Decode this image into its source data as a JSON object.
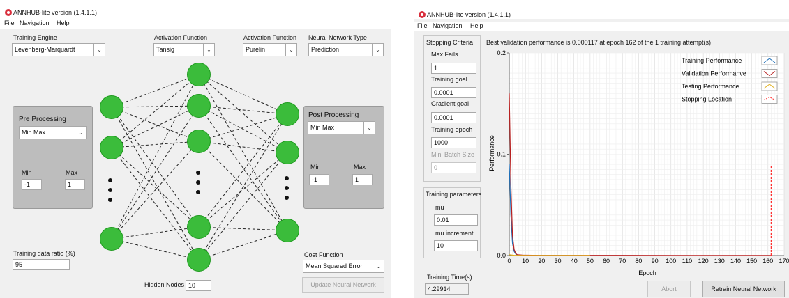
{
  "window1": {
    "title": "ANNHUB-lite version (1.4.1.1)",
    "menu": [
      "File",
      "Navigation",
      "Help"
    ],
    "training_engine": {
      "label": "Training Engine",
      "value": "Levenberg-Marquardt"
    },
    "activation1": {
      "label": "Activation Function",
      "value": "Tansig"
    },
    "activation2": {
      "label": "Activation Function",
      "value": "Purelin"
    },
    "nn_type": {
      "label": "Neural Network Type",
      "value": "Prediction"
    },
    "pre": {
      "title": "Pre Processing",
      "value": "Min Max",
      "min_label": "Min",
      "max_label": "Max",
      "min": "-1",
      "max": "1"
    },
    "post": {
      "title": "Post Processing",
      "value": "Min Max",
      "min_label": "Min",
      "max_label": "Max",
      "min": "-1",
      "max": "1"
    },
    "ratio": {
      "label": "Training data ratio (%)",
      "value": "95"
    },
    "hidden": {
      "label": "Hidden Nodes",
      "value": "10"
    },
    "cost": {
      "label": "Cost Function",
      "value": "Mean Squared Error"
    },
    "update_button": "Update Neural Network"
  },
  "window2": {
    "title": "ANNHUB-lite version (1.4.1.1)",
    "menu": [
      "File",
      "Navigation",
      "Help"
    ],
    "stopping_title": "Stopping Criteria",
    "max_fails": {
      "label": "Max Fails",
      "value": "1"
    },
    "training_goal": {
      "label": "Training goal",
      "value": "0.0001"
    },
    "gradient_goal": {
      "label": "Gradient goal",
      "value": "0.0001"
    },
    "training_epoch": {
      "label": "Training epoch",
      "value": "1000"
    },
    "mini_batch": {
      "label": "Mini Batch Size",
      "value": "0"
    },
    "params_title": "Training parameters",
    "mu": {
      "label": "mu",
      "value": "0.01"
    },
    "mu_inc": {
      "label": "mu increment",
      "value": "10"
    },
    "time": {
      "label": "Training Time(s)",
      "value": "4.29914"
    },
    "abort_button": "Abort",
    "retrain_button": "Retrain Neural Network"
  },
  "chart_data": {
    "type": "line",
    "title": "Best validation performance is 0.000117 at epoch 162 of the 1 training attempt(s)",
    "xlabel": "Epoch",
    "ylabel": "Performance",
    "xlim": [
      0,
      170
    ],
    "ylim": [
      0,
      0.2
    ],
    "xticks": [
      "0",
      "10",
      "20",
      "30",
      "40",
      "50",
      "60",
      "70",
      "80",
      "90",
      "100",
      "110",
      "120",
      "130",
      "140",
      "150",
      "160",
      "170"
    ],
    "yticks": [
      "0.0",
      "0.1",
      "0.2"
    ],
    "grid": true,
    "legend_position": "top-right",
    "series": [
      {
        "name": "Training Performance",
        "color": "#1f6fb8",
        "x": [
          0,
          1,
          2,
          3,
          4,
          5,
          8,
          20,
          45
        ],
        "y": [
          0.09,
          0.04,
          0.012,
          0.004,
          0.0015,
          0.0006,
          0.0003,
          0.00015,
          0.0001
        ]
      },
      {
        "name": "Validation Performanve",
        "color": "#b82020",
        "x": [
          0,
          1,
          2,
          3,
          4,
          5,
          8,
          20,
          100,
          162
        ],
        "y": [
          0.16,
          0.07,
          0.02,
          0.006,
          0.002,
          0.0008,
          0.0004,
          0.0002,
          0.00013,
          0.000117
        ]
      },
      {
        "name": "Testing Performance",
        "color": "#e0b020",
        "x": [
          0,
          1,
          2,
          3,
          5,
          10,
          50
        ],
        "y": [
          0.0008,
          0.0006,
          0.0004,
          0.0003,
          0.0002,
          0.00015,
          0.0001
        ]
      },
      {
        "name": "Stopping Location",
        "color": "#ff3030",
        "x": [
          162,
          162
        ],
        "y": [
          0,
          0.088
        ]
      }
    ]
  }
}
